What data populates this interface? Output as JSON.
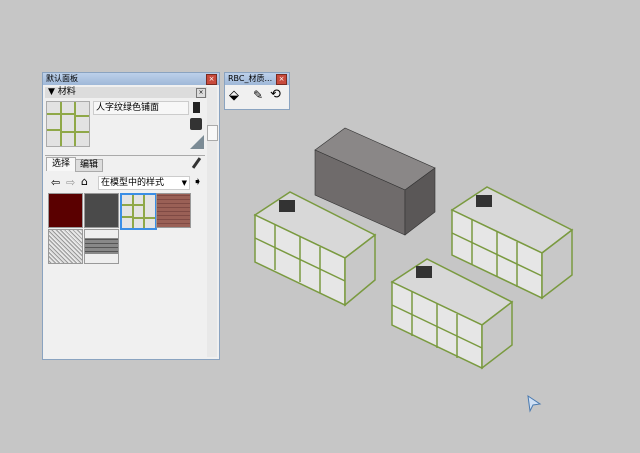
{
  "panel": {
    "title": "默认面板",
    "section": "材料",
    "material_name": "人字纹绿色铺面",
    "tabs": [
      "选择",
      "编辑"
    ],
    "collection": "在模型中的样式",
    "swatches": [
      {
        "name": "dark-red",
        "color": "#5a0000"
      },
      {
        "name": "dark-gray",
        "color": "#4a4a4a"
      },
      {
        "name": "herringbone-green",
        "color": "#e4e4e4"
      },
      {
        "name": "red-brick",
        "color": "#9a6056"
      },
      {
        "name": "granite",
        "color": "#cfcfcf"
      },
      {
        "name": "gray-brick",
        "color": "#8a8a8a"
      }
    ]
  },
  "toolbar": {
    "title": "RBC_材质..."
  },
  "colors": {
    "background": "#c6c6c6",
    "accent": "#3a8ee6"
  }
}
